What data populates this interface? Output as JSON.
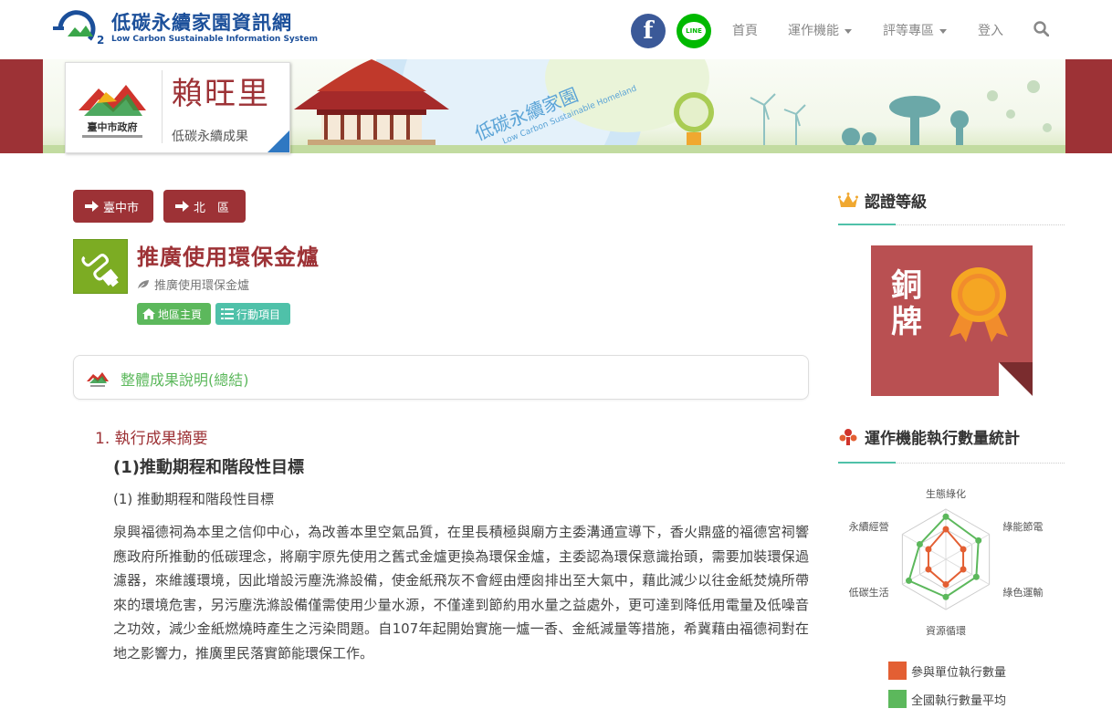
{
  "header": {
    "logo_title": "低碳永續家園資訊網",
    "logo_subtitle": "Low Carbon Sustainable Information System",
    "social": {
      "facebook": "f",
      "line": "LINE"
    },
    "nav": [
      {
        "label": "首頁"
      },
      {
        "label": "運作機能"
      },
      {
        "label": "評等專區"
      },
      {
        "label": "登入"
      }
    ]
  },
  "banner": {
    "village": "賴旺里",
    "subtitle": "低碳永續成果",
    "gov_logo_text": "臺中市政府",
    "slogan": "低碳永續家園",
    "slogan_en": "Low Carbon Sustainable Homeland"
  },
  "breadcrumb": {
    "city": "臺中市",
    "district": "北　區"
  },
  "project": {
    "title": "推廣使用環保金爐",
    "subtitle": "推廣使用環保金爐",
    "buttons": {
      "home": "地區主頁",
      "actions": "行動項目"
    }
  },
  "summary": {
    "title": "整體成果說明(總結)"
  },
  "content": {
    "section_number": "1.",
    "section_title": "執行成果摘要",
    "subsection_title": "(1)推動期程和階段性目標",
    "item_title": "(1)  推動期程和階段性目標",
    "paragraph": "泉興福德祠為本里之信仰中心，為改善本里空氣品質，在里長積極與廟方主委溝通宣導下，香火鼎盛的福德宮祠響應政府所推動的低碳理念，將廟宇原先使用之舊式金爐更換為環保金爐，主委認為環保意識抬頭，需要加裝環保過濾器，來維護環境，因此增設污塵洗滌設備，使金紙飛灰不會經由煙囪排出至大氣中，藉此減少以往金紙焚燒所帶來的環境危害，另污塵洗滌設備僅需使用少量水源，不僅達到節約用水量之益處外，更可達到降低用電量及低噪音之功效，減少金紙燃燒時產生之污染問題。自107年起開始實施一爐一香、金紙減量等措施，希冀藉由福德祠對在地之影響力，推廣里民落實節能環保工作。"
  },
  "sidebar": {
    "cert_title": "認證等級",
    "medal_text": "銅牌",
    "stats_title": "運作機能執行數量統計",
    "colors": {
      "participant": "#e35f33",
      "national": "#5cb85c"
    },
    "chart_data": {
      "type": "radar",
      "axes": [
        "生態綠化",
        "綠能節電",
        "綠色運輸",
        "資源循環",
        "低碳生活",
        "永續經營"
      ],
      "series": [
        {
          "name": "參與單位執行數量",
          "values": [
            0.6,
            0.4,
            0.4,
            0.5,
            0.4,
            0.4
          ]
        },
        {
          "name": "全國執行數量平均",
          "values": [
            0.85,
            0.75,
            0.7,
            0.75,
            0.85,
            0.6
          ]
        }
      ]
    }
  }
}
